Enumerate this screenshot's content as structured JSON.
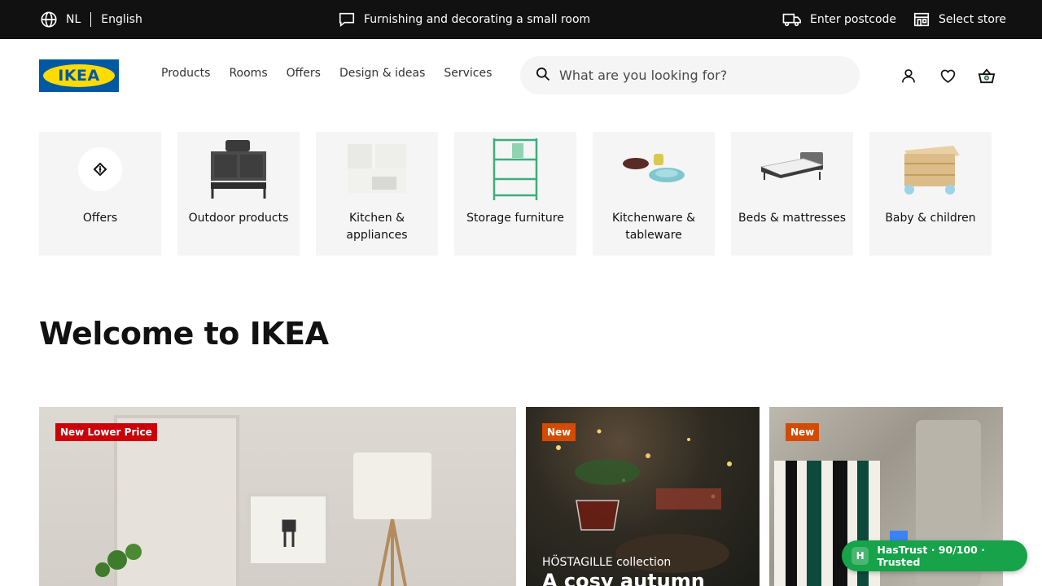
{
  "topbar": {
    "lang_code": "NL",
    "lang_name": "English",
    "promo": "Furnishing and decorating a small room",
    "postcode": "Enter postcode",
    "store": "Select store"
  },
  "header": {
    "logo_text": "IKEA",
    "nav": [
      "Products",
      "Rooms",
      "Offers",
      "Design & ideas",
      "Services"
    ],
    "search_placeholder": "What are you looking for?"
  },
  "categories": [
    {
      "label": "Offers",
      "icon": "offer-tag-icon"
    },
    {
      "label": "Outdoor products",
      "icon": "outdoor-kitchen-icon"
    },
    {
      "label": "Kitchen & appliances",
      "icon": "kitchen-cabinet-icon"
    },
    {
      "label": "Storage furniture",
      "icon": "shelf-unit-icon"
    },
    {
      "label": "Kitchenware & tableware",
      "icon": "bowls-icon"
    },
    {
      "label": "Beds & mattresses",
      "icon": "bed-icon"
    },
    {
      "label": "Baby & children",
      "icon": "toy-box-icon"
    }
  ],
  "welcome": "Welcome to IKEA",
  "cards": [
    {
      "badge": "New Lower Price"
    },
    {
      "badge": "New",
      "subtitle": "HÖSTAGILLE collection",
      "title": "A cosy autumn"
    },
    {
      "badge": "New"
    }
  ],
  "trust_badge": {
    "icon_letter": "H",
    "text": "HasTrust · 90/100 · Trusted"
  },
  "colors": {
    "topbar_bg": "#111111",
    "ikea_blue": "#0058a3",
    "ikea_yellow": "#ffdb00",
    "badge_red": "#cc0008",
    "badge_orange": "#d34b00",
    "trust_green": "#16a34a"
  }
}
